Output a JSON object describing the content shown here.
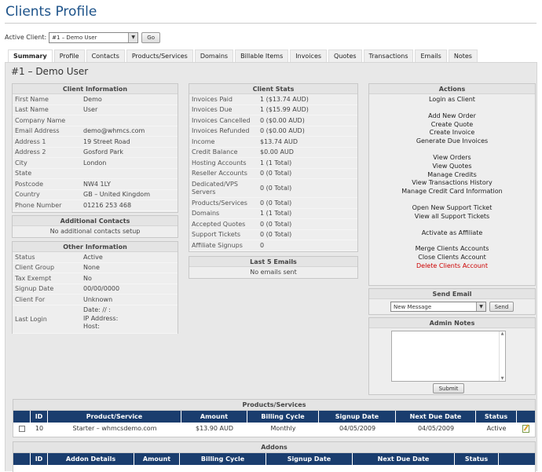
{
  "page": {
    "title": "Clients Profile"
  },
  "active_client": {
    "label": "Active Client:",
    "value": "#1 – Demo User",
    "go_label": "Go"
  },
  "tabs": [
    {
      "label": "Summary",
      "active": true
    },
    {
      "label": "Profile"
    },
    {
      "label": "Contacts"
    },
    {
      "label": "Products/Services"
    },
    {
      "label": "Domains"
    },
    {
      "label": "Billable Items"
    },
    {
      "label": "Invoices"
    },
    {
      "label": "Quotes"
    },
    {
      "label": "Transactions"
    },
    {
      "label": "Emails"
    },
    {
      "label": "Notes"
    }
  ],
  "client_heading": "#1 – Demo User",
  "client_info": {
    "title": "Client Information",
    "rows": [
      {
        "k": "First Name",
        "v": "Demo"
      },
      {
        "k": "Last Name",
        "v": "User"
      },
      {
        "k": "Company Name",
        "v": ""
      },
      {
        "k": "Email Address",
        "v": "demo@whmcs.com"
      },
      {
        "k": "Address 1",
        "v": "19 Street Road"
      },
      {
        "k": "Address 2",
        "v": "Gosford Park"
      },
      {
        "k": "City",
        "v": "London"
      },
      {
        "k": "State",
        "v": ""
      },
      {
        "k": "Postcode",
        "v": "NW4 1LY"
      },
      {
        "k": "Country",
        "v": "GB – United Kingdom"
      },
      {
        "k": "Phone Number",
        "v": "01216 253 468"
      }
    ]
  },
  "additional_contacts": {
    "title": "Additional Contacts",
    "text": "No additional contacts setup"
  },
  "other_info": {
    "title": "Other Information",
    "rows": [
      {
        "k": "Status",
        "v": "Active"
      },
      {
        "k": "Client Group",
        "v": "None"
      },
      {
        "k": "Tax Exempt",
        "v": "No"
      },
      {
        "k": "Signup Date",
        "v": "00/00/0000"
      },
      {
        "k": "Client For",
        "v": "Unknown"
      }
    ],
    "last_login": {
      "k": "Last Login",
      "date": "Date: // :",
      "ip": "IP Address:",
      "host": "Host:"
    }
  },
  "client_stats": {
    "title": "Client Stats",
    "rows": [
      {
        "k": "Invoices Paid",
        "v": "1 ($13.74 AUD)"
      },
      {
        "k": "Invoices Due",
        "v": "1 ($15.99 AUD)"
      },
      {
        "k": "Invoices Cancelled",
        "v": "0 ($0.00 AUD)"
      },
      {
        "k": "Invoices Refunded",
        "v": "0 ($0.00 AUD)"
      },
      {
        "k": "Income",
        "v": "$13.74 AUD"
      },
      {
        "k": "Credit Balance",
        "v": "$0.00 AUD"
      },
      {
        "k": "Hosting Accounts",
        "v": "1 (1 Total)"
      },
      {
        "k": "Reseller Accounts",
        "v": "0 (0 Total)"
      },
      {
        "k": "Dedicated/VPS Servers",
        "v": "0 (0 Total)"
      },
      {
        "k": "Products/Services",
        "v": "0 (0 Total)"
      },
      {
        "k": "Domains",
        "v": "1 (1 Total)"
      },
      {
        "k": "Accepted Quotes",
        "v": "0 (0 Total)"
      },
      {
        "k": "Support Tickets",
        "v": "0 (0 Total)"
      },
      {
        "k": "Affiliate Signups",
        "v": "0"
      }
    ]
  },
  "last_emails": {
    "title": "Last 5 Emails",
    "text": "No emails sent"
  },
  "actions": {
    "title": "Actions",
    "group1": [
      "Login as Client"
    ],
    "group2": [
      "Add New Order",
      "Create Quote",
      "Create Invoice",
      "Generate Due Invoices"
    ],
    "group3": [
      "View Orders",
      "View Quotes",
      "Manage Credits",
      "View Transactions History",
      "Manage Credit Card Information"
    ],
    "group4": [
      "Open New Support Ticket",
      "View all Support Tickets"
    ],
    "group5": [
      "Activate as Affiliate"
    ],
    "group6": [
      "Merge Clients Accounts",
      "Close Clients Account"
    ],
    "delete": "Delete Clients Account"
  },
  "send_email": {
    "title": "Send Email",
    "selected": "New Message",
    "button": "Send"
  },
  "admin_notes": {
    "title": "Admin Notes",
    "button": "Submit"
  },
  "products": {
    "title": "Products/Services",
    "headers": [
      "",
      "ID",
      "Product/Service",
      "Amount",
      "Billing Cycle",
      "Signup Date",
      "Next Due Date",
      "Status",
      ""
    ],
    "row": {
      "id": "10",
      "product": "Starter – whmcsdemo.com",
      "amount": "$13.90 AUD",
      "cycle": "Monthly",
      "signup": "04/05/2009",
      "due": "04/05/2009",
      "status": "Active"
    }
  },
  "addons": {
    "title": "Addons",
    "headers": [
      "",
      "ID",
      "Addon Details",
      "Amount",
      "Billing Cycle",
      "Signup Date",
      "Next Due Date",
      "Status",
      ""
    ]
  },
  "colors": {
    "title": "#1c5289",
    "table_header": "#1a3d6e",
    "delete_link": "#cc0000"
  }
}
